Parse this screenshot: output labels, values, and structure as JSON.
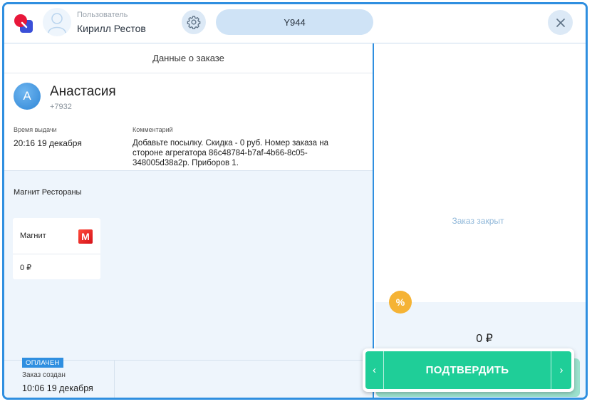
{
  "header": {
    "user_caption": "Пользователь",
    "user_name": "Кирилл Рестов",
    "order_code": "Y944"
  },
  "order": {
    "panel_title": "Данные о заказе",
    "customer": {
      "initial": "А",
      "name": "Анастасия",
      "phone": "+7932"
    },
    "pickup_time_label": "Время выдачи",
    "pickup_time": "20:16 19 декабря",
    "comment_label": "Комментарий",
    "comment": "Добавьте посылку. Скидка - 0  руб. Номер заказа на стороне агрегатора 86c48784-b7af-4b66-8c05-348005d38a2p. Приборов 1.",
    "group_title": "Магнит Рестораны",
    "partner": {
      "name": "Магнит",
      "logo_letter": "М",
      "amount": "0 ₽"
    },
    "status_badge": "ОПЛАЧЕН",
    "created_label": "Заказ создан",
    "created_value": "10:06 19 декабря"
  },
  "right_panel": {
    "closed_text": "Заказ закрыт",
    "discount_symbol": "%",
    "total": "0 ₽"
  },
  "confirm": {
    "label": "ПОДТВЕРДИТЬ",
    "prev_symbol": "‹",
    "next_symbol": "›"
  },
  "colors": {
    "accent": "#2f8fe0",
    "confirm": "#1fce98",
    "discount": "#f5b335",
    "panel_bg": "#eef5fc"
  },
  "icons": [
    "app-logo-icon",
    "user-placeholder-icon",
    "gear-icon",
    "close-icon",
    "percent-icon",
    "chevron-left-icon",
    "chevron-right-icon"
  ]
}
